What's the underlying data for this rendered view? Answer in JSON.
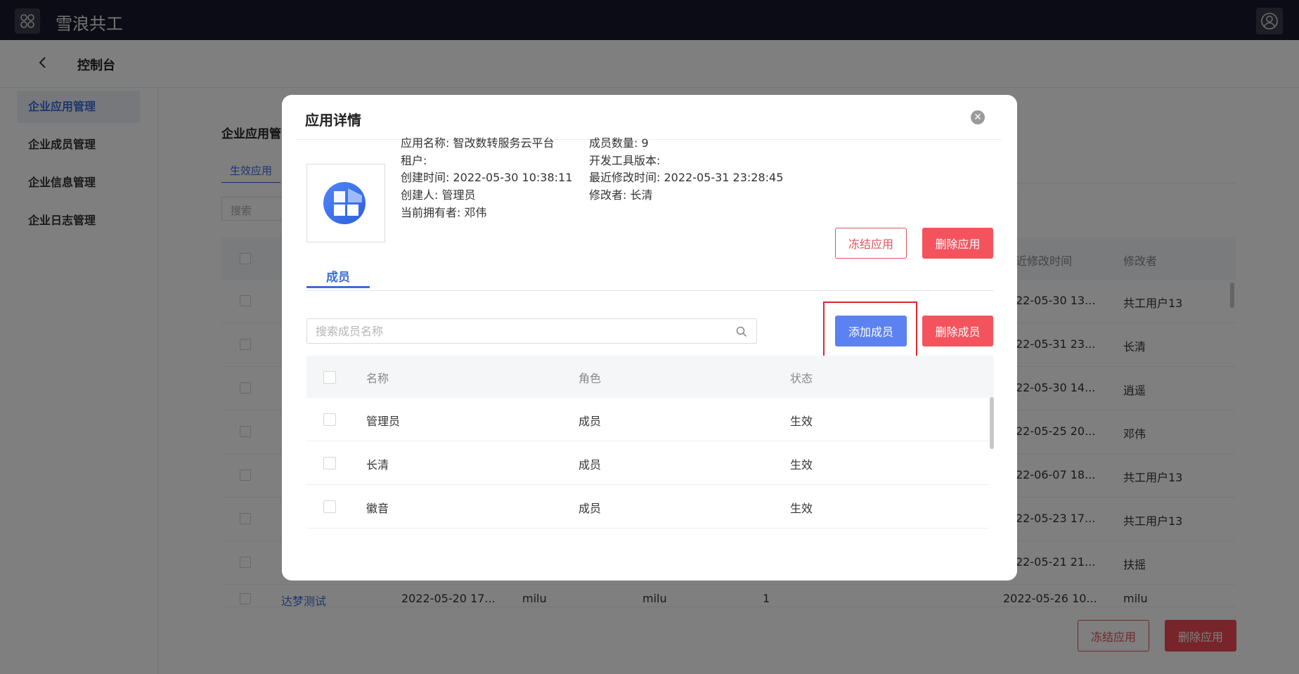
{
  "app": {
    "title": "雪浪共工"
  },
  "header": {
    "title": "控制台"
  },
  "sidebar": {
    "items": [
      {
        "label": "企业应用管理"
      },
      {
        "label": "企业成员管理"
      },
      {
        "label": "企业信息管理"
      },
      {
        "label": "企业日志管理"
      }
    ]
  },
  "background": {
    "title": "企业应用管",
    "tab": "生效应用",
    "search_placeholder": "搜索",
    "columns": {
      "modified_time": "近修改时间",
      "modifier": "修改者"
    },
    "rows": [
      {
        "modified_time": "22-05-30 13...",
        "modifier": "共工用户13"
      },
      {
        "modified_time": "22-05-31 23...",
        "modifier": "长清"
      },
      {
        "modified_time": "22-05-30 14...",
        "modifier": "逍遥"
      },
      {
        "modified_time": "22-05-25 20...",
        "modifier": "邓伟"
      },
      {
        "modified_time": "22-06-07 18...",
        "modifier": "共工用户13"
      },
      {
        "modified_time": "22-05-23 17...",
        "modifier": "共工用户13"
      },
      {
        "modified_time": "22-05-21 21...",
        "modifier": "扶摇"
      }
    ],
    "last_row": {
      "name": "达梦测试",
      "created_time": "2022-05-20 17...",
      "creator": "milu",
      "owner": "milu",
      "count": "1",
      "modified_time": "2022-05-26 10...",
      "modifier": "milu"
    },
    "freeze_label": "冻结应用",
    "delete_label": "删除应用"
  },
  "modal": {
    "title": "应用详情",
    "info": {
      "app_name": "应用名称: 智改数转服务云平台",
      "tenant": "租户:",
      "created_time": "创建时间: 2022-05-30 10:38:11",
      "creator": "创建人: 管理员",
      "owner": "当前拥有者: 邓伟",
      "member_count": "成员数量: 9",
      "dev_tool_version": "开发工具版本:",
      "last_modified": "最近修改时间: 2022-05-31 23:28:45",
      "modifier": "修改者: 长清"
    },
    "freeze_label": "冻结应用",
    "delete_app_label": "删除应用",
    "tab": "成员",
    "search_placeholder": "搜索成员名称",
    "add_member_label": "添加成员",
    "delete_member_label": "删除成员",
    "columns": {
      "name": "名称",
      "role": "角色",
      "status": "状态"
    },
    "members": [
      {
        "name": "管理员",
        "role": "成员",
        "status": "生效"
      },
      {
        "name": "长清",
        "role": "成员",
        "status": "生效"
      },
      {
        "name": "徽音",
        "role": "成员",
        "status": "生效"
      }
    ]
  },
  "colors": {
    "topbar": "#16192a",
    "accent": "#3b6fd8",
    "danger": "#f4535e",
    "primary_button": "#5b82f0",
    "highlight": "#e0252f"
  },
  "icons": [
    "apps-grid-icon",
    "user-circle-icon",
    "back-arrow-icon",
    "close-icon",
    "search-icon",
    "app-logo-icon"
  ]
}
